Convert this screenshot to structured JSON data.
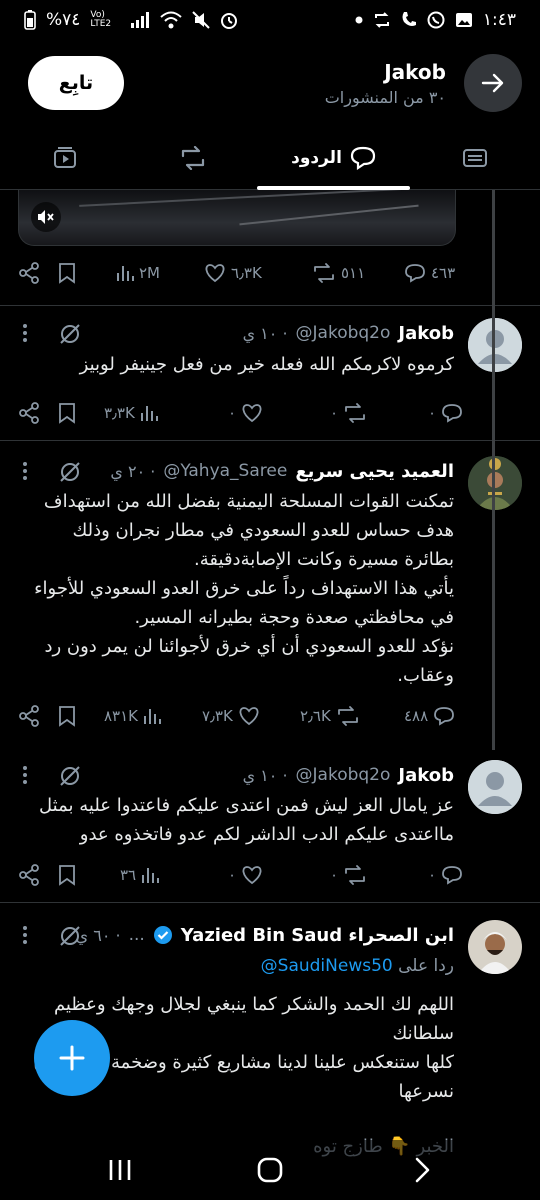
{
  "status_bar": {
    "time": "١:٤٣",
    "battery": "%٧٤",
    "network": "Vo) LTE2"
  },
  "header": {
    "name": "Jakob",
    "subtitle": "٣٠ من المنشورات",
    "follow_label": "تابِع"
  },
  "tabs": {
    "replies_label": "الردود",
    "active": "replies"
  },
  "media_stats": {
    "replies": "٤٦٣",
    "reposts": "٥١١",
    "likes": "٦٫٣K",
    "views": "٢M"
  },
  "posts": [
    {
      "name": "Jakob",
      "handle": "@Jakobq2o",
      "time": "١٠ ي",
      "text": "كرموه لاكرمكم الله فعله خير من فعل جينيفر لوبيز",
      "replies": "٠",
      "reposts": "٠",
      "likes": "٠",
      "views": "٣٫٣K"
    },
    {
      "name": "العميد يحيى سريع",
      "handle": "@Yahya_Saree",
      "time": "٢٠ ي",
      "text": "تمكنت القوات المسلحة اليمنية بفضل الله من  استهداف هدف حساس للعدو السعودي في مطار نجران وذلك بطائرة مسيرة وكانت الإصابةدقيقة.\nيأتي هذا الاستهداف رداً على خرق  العدو السعودي للأجواء في محافظتي صعدة وحجة بطيرانه المسير.\nنؤكد للعدو السعودي أن أي خرق لأجوائنا لن يمر دون رد وعقاب.",
      "replies": "٤٨٨",
      "reposts": "٢٫٦K",
      "likes": "٧٫٣K",
      "views": "٨٣١K"
    },
    {
      "name": "Jakob",
      "handle": "@Jakobq2o",
      "time": "١٠ ي",
      "text": "عز يامال العز ليش فمن اعتدى عليكم فاعتدوا عليه بمثل مااعتدى عليكم الدب الداشر لكم عدو فاتخذوه عدو",
      "replies": "٠",
      "reposts": "٠",
      "likes": "٠",
      "views": "٣٦"
    },
    {
      "name": "ابن الصحراء Yazied Bin Saud",
      "handle": "...",
      "time": "٦٠ ي",
      "reply_prefix": "ردا على",
      "reply_mention": "@SaudiNews50",
      "text": "اللهم لك الحمد والشكر كما ينبغي لجلال وجهك وعظيم سلطانك\nكلها ستنعكس علينا لدينا مشاريع كثيرة وضخمة ونحتاج ان نسرعها",
      "footer": "الخبر 👇 طازج توه"
    }
  ],
  "colors": {
    "accent": "#1d9bf0",
    "background": "#000000",
    "secondary_text": "#8b98a5",
    "divider": "#2f3336",
    "verified": "#1d9bf0"
  }
}
